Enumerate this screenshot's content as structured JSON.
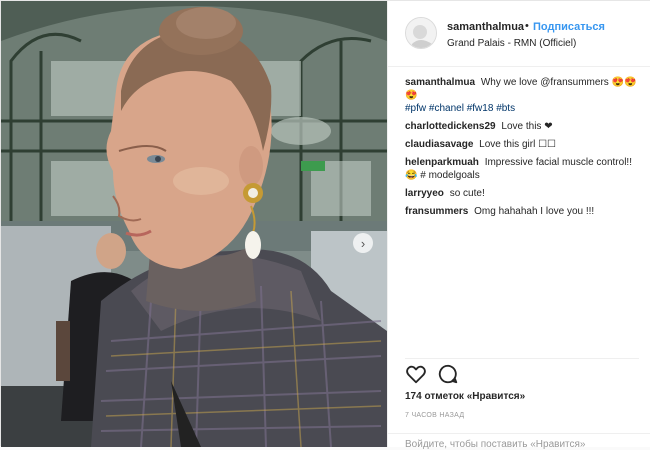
{
  "post": {
    "username": "samanthalmua",
    "separator": "•",
    "follow_label": "Подписаться",
    "location": "Grand Palais - RMN (Officiel)",
    "image_alt": "Model with hair in a bun wearing a pearl drop earring and a tweed coat, backstage at Grand Palais"
  },
  "caption": {
    "username": "samanthalmua",
    "text": "Why we love @fransummers 😍😍😍",
    "tags": [
      "#pfw",
      "#chanel",
      "#fw18",
      "#bts"
    ]
  },
  "comments": [
    {
      "username": "charlottedickens29",
      "text": "Love this ❤"
    },
    {
      "username": "claudiasavage",
      "text": "Love this girl ☐☐"
    },
    {
      "username": "helenparkmuah",
      "text": "Impressive facial muscle control!! 😂 # modelgoals"
    },
    {
      "username": "larryyeo",
      "text": "so cute!"
    },
    {
      "username": "fransummers",
      "text": "Omg hahahah I love you !!!"
    }
  ],
  "actions": {
    "like_icon": "heart-icon",
    "comment_icon": "comment-icon",
    "likes_text": "174 отметок «Нравится»",
    "time_text": "7 ЧАСОВ НАЗАД"
  },
  "footer": {
    "text": "Войдите, чтобы поставить «Нравится»"
  },
  "colors": {
    "link_blue": "#3897f0",
    "tag_blue": "#003569",
    "text": "#262626",
    "muted": "#999999"
  }
}
